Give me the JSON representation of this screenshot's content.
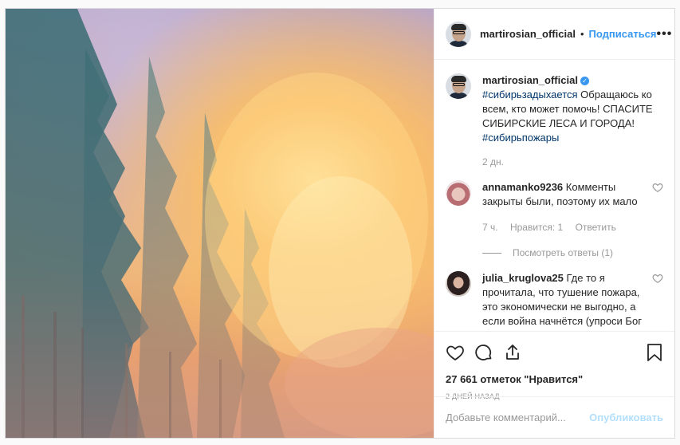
{
  "post": {
    "author": "martirosian_official",
    "follow_label": "Подписаться",
    "more_label": "•••",
    "caption": {
      "tag1": "#сибирьзадыхается",
      "text": " Обращаюсь ко всем, кто может помочь! СПАСИТЕ СИБИРСКИЕ ЛЕСА И ГОРОДА!",
      "tag2": "#сибирьпожары",
      "time": "2 дн."
    },
    "comments": [
      {
        "user": "annamanko9236",
        "text": "Комменты закрыты были, поэтому их мало",
        "time": "7 ч.",
        "likes": "Нравится: 1",
        "reply_label": "Ответить",
        "view_replies": "Посмотреть ответы (1)"
      },
      {
        "user": "julia_kruglova25",
        "text": "Где то я прочитала, что тушение пожара, это экономически не выгодно, а если война начнётся (упроси Бог🙏🏾) А на парадах гордимся своими самолетами, а"
      }
    ],
    "likes_count": "27 661 отметок \"Нравится\"",
    "date": "2 ДНЕЙ НАЗАД",
    "comment_placeholder": "Добавьте комментарий...",
    "publish_label": "Опубликовать",
    "verified_mark": "✓"
  },
  "colors": {
    "accent": "#3897f0",
    "publish_disabled": "#b2dffc",
    "muted": "#999999",
    "hashtag": "#003569"
  }
}
